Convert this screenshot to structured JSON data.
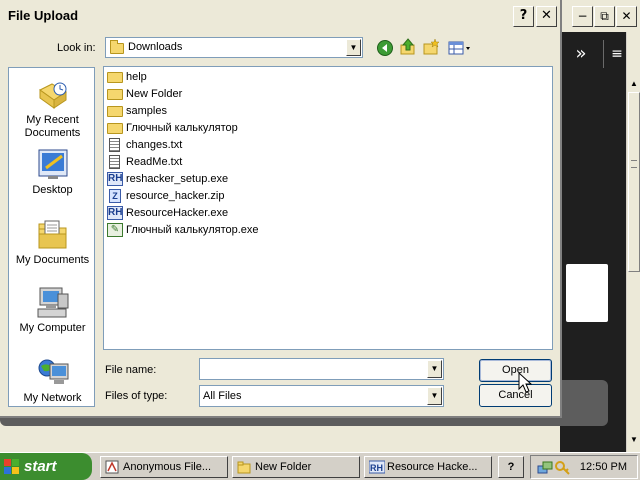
{
  "dialog": {
    "title": "File Upload",
    "help_button": "?",
    "close_button": "✕"
  },
  "background_window": {
    "minimize": "−",
    "restore": "⧉",
    "close": "✕",
    "nav_chevron": "»",
    "menu": "≡"
  },
  "look_in": {
    "label": "Look in:",
    "value": "Downloads"
  },
  "places": [
    {
      "label": "My Recent Documents"
    },
    {
      "label": "Desktop"
    },
    {
      "label": "My Documents"
    },
    {
      "label": "My Computer"
    },
    {
      "label": "My Network"
    }
  ],
  "files": [
    {
      "name": "help",
      "type": "folder"
    },
    {
      "name": "New Folder",
      "type": "folder"
    },
    {
      "name": "samples",
      "type": "folder"
    },
    {
      "name": "Глючный калькулятор",
      "type": "folder"
    },
    {
      "name": "changes.txt",
      "type": "txt"
    },
    {
      "name": "ReadMe.txt",
      "type": "txt"
    },
    {
      "name": "reshacker_setup.exe",
      "type": "rh"
    },
    {
      "name": "resource_hacker.zip",
      "type": "zip"
    },
    {
      "name": "ResourceHacker.exe",
      "type": "rh"
    },
    {
      "name": "Глючный калькулятор.exe",
      "type": "exe"
    }
  ],
  "file_name": {
    "label": "File name:",
    "value": ""
  },
  "file_type": {
    "label": "Files of type:",
    "value": "All Files"
  },
  "buttons": {
    "open": "Open",
    "cancel": "Cancel"
  },
  "taskbar": {
    "start": "start",
    "tasks": [
      {
        "label": "Anonymous File..."
      },
      {
        "label": "New Folder"
      },
      {
        "label": "Resource Hacke..."
      },
      {
        "label": "?"
      }
    ],
    "clock": "12:50 PM"
  },
  "colors": {
    "dialog_bg": "#ece9d8",
    "start_green": "#3c8d2f",
    "field_border": "#7f9db9"
  }
}
